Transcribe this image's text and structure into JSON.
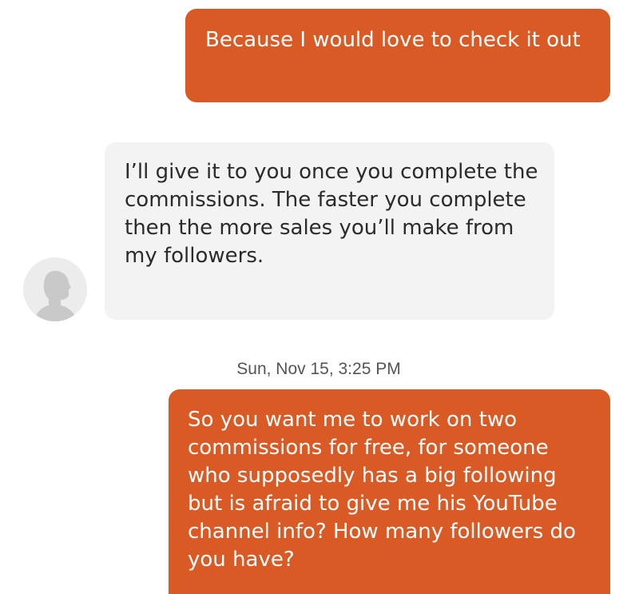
{
  "conversation": {
    "messages": [
      {
        "direction": "outgoing",
        "text": "Because I would love to check it out"
      },
      {
        "direction": "incoming",
        "text": "I’ll give it to you once you complete the commissions. The faster you complete then the more sales you’ll make from my followers."
      },
      {
        "direction": "outgoing",
        "text": "So you want me to work on two commissions for free, for someone who supposedly has a big following but is afraid to give me his YouTube channel info? How many followers do you have?"
      }
    ],
    "timestamp": "Sun, Nov 15, 3:25 PM",
    "avatar_icon": "user-silhouette-icon"
  },
  "colors": {
    "outgoing_bubble": "#d95a24",
    "incoming_bubble": "#f3f3f3",
    "timestamp_text": "#555555"
  }
}
